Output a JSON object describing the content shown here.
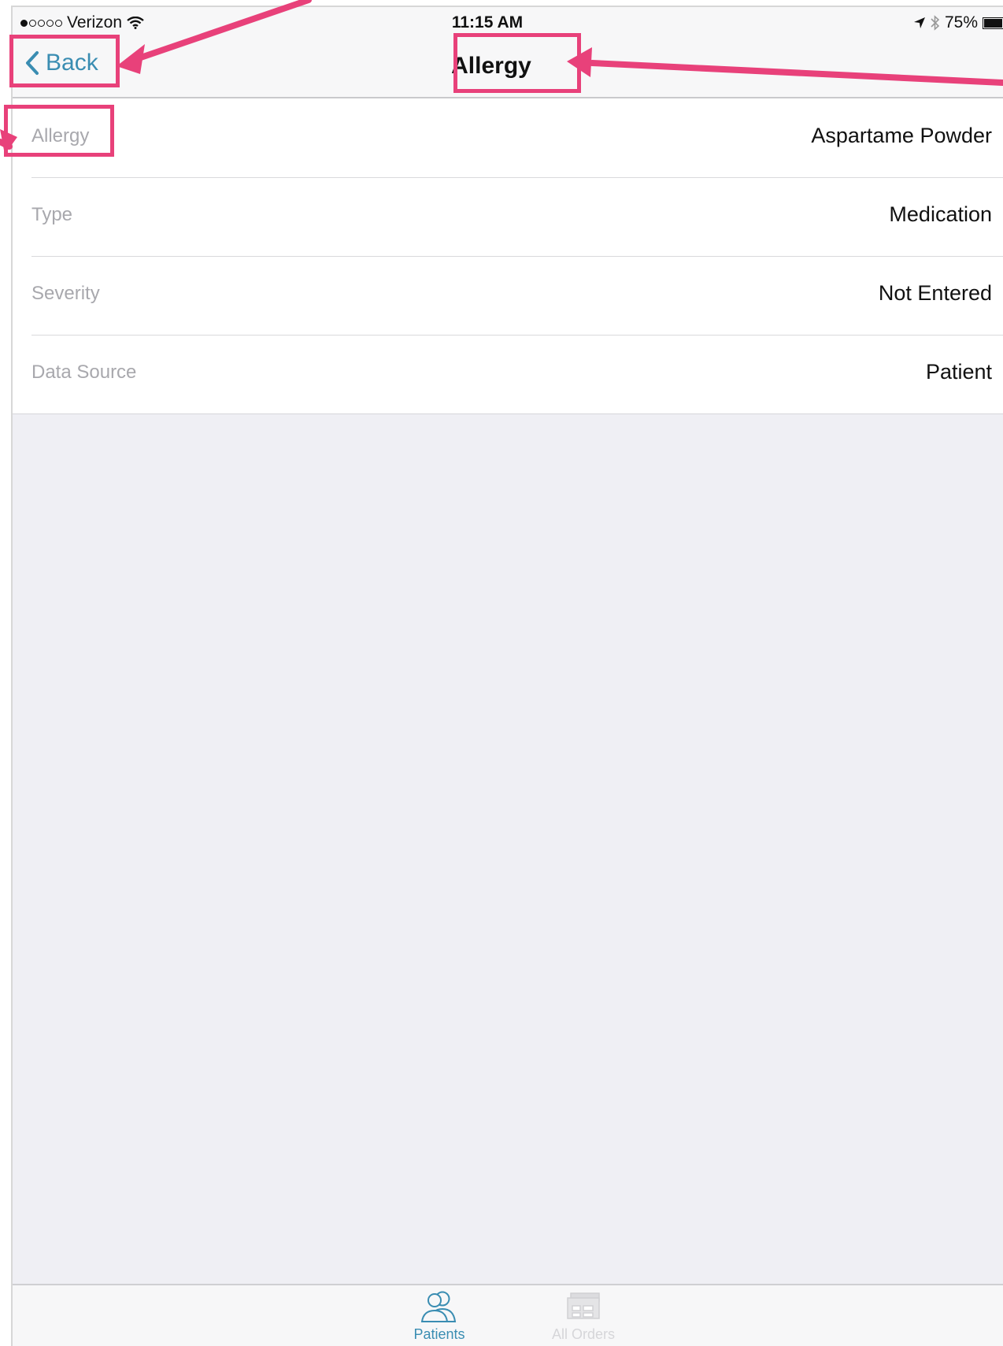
{
  "status_bar": {
    "carrier": "Verizon",
    "time": "11:15 AM",
    "battery": "75%",
    "battery_level": 0.75
  },
  "nav": {
    "back_label": "Back",
    "title": "Allergy"
  },
  "details": [
    {
      "label": "Allergy",
      "value": "Aspartame Powder"
    },
    {
      "label": "Type",
      "value": "Medication"
    },
    {
      "label": "Severity",
      "value": "Not Entered"
    },
    {
      "label": "Data Source",
      "value": "Patient"
    }
  ],
  "tabs": [
    {
      "label": "Patients",
      "icon": "patients-icon",
      "active": true
    },
    {
      "label": "All Orders",
      "icon": "orders-icon",
      "active": false
    }
  ],
  "colors": {
    "accent": "#3a8db2",
    "annotation": "#e8417a",
    "background": "#efeff4"
  }
}
